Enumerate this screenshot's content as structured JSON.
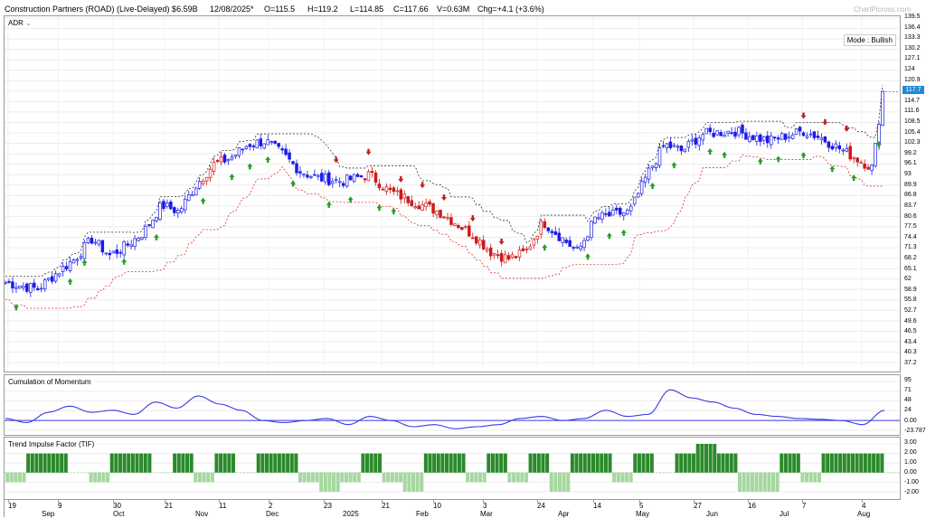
{
  "header": {
    "title": "Construction Partners (ROAD) (Live-Delayed) $6.59B",
    "date": "12/08/2025*",
    "open": "O=115.5",
    "high": "H=119.2",
    "low": "L=114.85",
    "close": "C=117.66",
    "volume": "V=0.63M",
    "change": "Chg=+4.1 (+3.6%)",
    "watermark": "ChartPicross.com"
  },
  "price_panel": {
    "label": "ADR",
    "mode": "Mode : Bullish",
    "last_price_tag": "117.7",
    "y_ticks": [
      "139.5",
      "136.4",
      "133.3",
      "130.2",
      "127.1",
      "124",
      "120.9",
      "117.8",
      "114.7",
      "111.6",
      "108.5",
      "105.4",
      "102.3",
      "99.2",
      "96.1",
      "93",
      "89.9",
      "86.8",
      "83.7",
      "80.6",
      "77.5",
      "74.4",
      "71.3",
      "68.2",
      "65.1",
      "62",
      "58.9",
      "55.8",
      "52.7",
      "49.6",
      "46.5",
      "43.4",
      "40.3",
      "37.2"
    ]
  },
  "momentum_panel": {
    "label": "Cumulation of Momentum",
    "y_ticks": [
      "95",
      "71",
      "48",
      "24",
      "0.00",
      "-23.787"
    ]
  },
  "tif_panel": {
    "label": "Trend Impulse Factor (TIF)",
    "y_ticks": [
      "3.00",
      "2.00",
      "1.00",
      "0.00",
      "-1.00",
      "-2.00"
    ]
  },
  "x_axis": {
    "day_labels": [
      "19",
      "9",
      "30",
      "21",
      "11",
      "2",
      "23",
      "21",
      "10",
      "3",
      "24",
      "14",
      "5",
      "27",
      "16",
      "7",
      "4"
    ],
    "month_labels": [
      "Sep",
      "Oct",
      "Nov",
      "Dec",
      "2025",
      "Feb",
      "Mar",
      "Apr",
      "May",
      "Jun",
      "Jul",
      "Aug"
    ]
  },
  "colors": {
    "bull": "#1a1ae6",
    "bear": "#cc1a1a",
    "up_arrow": "#22a022",
    "down_arrow": "#c02020",
    "momentum": "#3a3ae0",
    "tif_strong": "#2a8a2a",
    "tif_weak": "#a6d8a0",
    "price_tag": "#1f8ad6"
  },
  "chart_data": [
    {
      "type": "candlestick",
      "title": "ADR",
      "ylim": [
        37.2,
        139.5
      ],
      "close_path": [
        {
          "x": "2024-08-19",
          "y": 61
        },
        {
          "x": "2024-09-01",
          "y": 59
        },
        {
          "x": "2024-09-09",
          "y": 64
        },
        {
          "x": "2024-09-16",
          "y": 68
        },
        {
          "x": "2024-09-23",
          "y": 74
        },
        {
          "x": "2024-09-30",
          "y": 69
        },
        {
          "x": "2024-10-07",
          "y": 72
        },
        {
          "x": "2024-10-14",
          "y": 76
        },
        {
          "x": "2024-10-21",
          "y": 84
        },
        {
          "x": "2024-10-28",
          "y": 82
        },
        {
          "x": "2024-11-04",
          "y": 90
        },
        {
          "x": "2024-11-11",
          "y": 96
        },
        {
          "x": "2024-11-18",
          "y": 98
        },
        {
          "x": "2024-11-25",
          "y": 102
        },
        {
          "x": "2024-12-02",
          "y": 103
        },
        {
          "x": "2024-12-09",
          "y": 99
        },
        {
          "x": "2024-12-16",
          "y": 94
        },
        {
          "x": "2024-12-23",
          "y": 92
        },
        {
          "x": "2025-01-02",
          "y": 91
        },
        {
          "x": "2025-01-13",
          "y": 93
        },
        {
          "x": "2025-01-21",
          "y": 88
        },
        {
          "x": "2025-02-03",
          "y": 84
        },
        {
          "x": "2025-02-10",
          "y": 82
        },
        {
          "x": "2025-02-24",
          "y": 75
        },
        {
          "x": "2025-03-03",
          "y": 70
        },
        {
          "x": "2025-03-10",
          "y": 68
        },
        {
          "x": "2025-03-17",
          "y": 70
        },
        {
          "x": "2025-03-24",
          "y": 79
        },
        {
          "x": "2025-04-07",
          "y": 70
        },
        {
          "x": "2025-04-14",
          "y": 80
        },
        {
          "x": "2025-04-28",
          "y": 82
        },
        {
          "x": "2025-05-05",
          "y": 93
        },
        {
          "x": "2025-05-12",
          "y": 102
        },
        {
          "x": "2025-05-19",
          "y": 100
        },
        {
          "x": "2025-05-27",
          "y": 105
        },
        {
          "x": "2025-06-09",
          "y": 106
        },
        {
          "x": "2025-06-23",
          "y": 103
        },
        {
          "x": "2025-07-07",
          "y": 106
        },
        {
          "x": "2025-07-14",
          "y": 104
        },
        {
          "x": "2025-07-21",
          "y": 101
        },
        {
          "x": "2025-08-04",
          "y": 95
        },
        {
          "x": "2025-08-08",
          "y": 117.66
        }
      ]
    },
    {
      "type": "line",
      "title": "Cumulation of Momentum",
      "ylim": [
        -23.787,
        95
      ],
      "values": [
        5,
        -5,
        20,
        35,
        20,
        25,
        15,
        45,
        30,
        60,
        40,
        25,
        0,
        -5,
        0,
        5,
        -10,
        10,
        0,
        -15,
        -10,
        -20,
        -15,
        -10,
        5,
        10,
        0,
        5,
        25,
        10,
        15,
        75,
        55,
        45,
        30,
        15,
        10,
        5,
        3,
        0,
        -10,
        25
      ]
    },
    {
      "type": "bar",
      "title": "Trend Impulse Factor (TIF)",
      "ylim": [
        -2,
        3
      ],
      "values": [
        -1,
        2,
        2,
        0,
        -1,
        2,
        2,
        0,
        2,
        -1,
        2,
        0,
        2,
        2,
        -1,
        -2,
        -1,
        2,
        -1,
        -2,
        2,
        2,
        -1,
        2,
        -1,
        2,
        -2,
        2,
        2,
        -1,
        2,
        0,
        2,
        3,
        2,
        -2,
        -2,
        2,
        -1,
        2,
        2,
        2
      ]
    }
  ]
}
